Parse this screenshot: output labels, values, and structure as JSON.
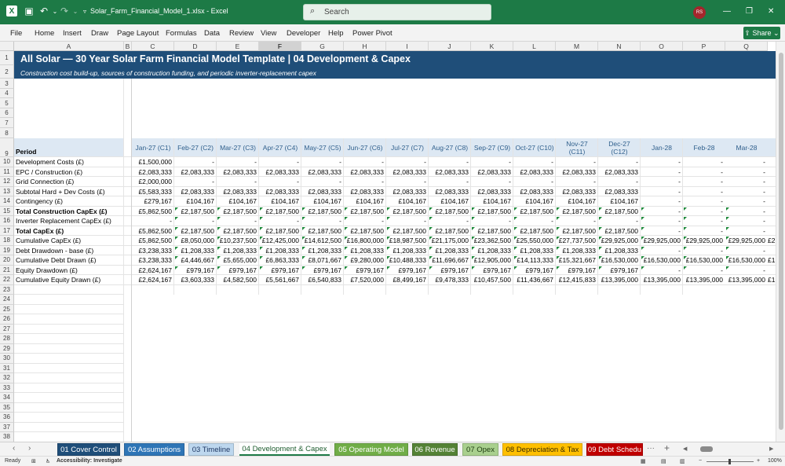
{
  "window": {
    "filename": "Solar_Farm_Financial_Model_1.xlsx",
    "app": "Excel",
    "title_sep": " - ",
    "search_placeholder": "Search",
    "user_initials": "RS"
  },
  "menu": [
    "File",
    "Home",
    "Insert",
    "Draw",
    "Page Layout",
    "Formulas",
    "Data",
    "Review",
    "View",
    "Developer",
    "Help",
    "Power Pivot"
  ],
  "share_label": "Share",
  "columns": [
    "A",
    "B",
    "C",
    "D",
    "E",
    "F",
    "G",
    "H",
    "I",
    "J",
    "K",
    "L",
    "M",
    "N",
    "O",
    "P",
    "Q"
  ],
  "selected_column": "F",
  "banner": {
    "title": "All Solar  —  30 Year Solar Farm Financial Model Template | 04 Development & Capex",
    "subtitle": "Construction cost build-up, sources of construction funding, and periodic inverter-replacement capex"
  },
  "period_label": "Period",
  "periods": [
    "Jan-27 (C1)",
    "Feb-27 (C2)",
    "Mar-27 (C3)",
    "Apr-27 (C4)",
    "May-27 (C5)",
    "Jun-27 (C6)",
    "Jul-27 (C7)",
    "Aug-27 (C8)",
    "Sep-27 (C9)",
    "Oct-27 (C10)",
    "Nov-27\n(C11)",
    "Dec-27\n(C12)",
    "Jan-28",
    "Feb-28",
    "Mar-28"
  ],
  "rows": [
    {
      "n": 10,
      "label": "Development Costs (£)",
      "bold": false,
      "values": [
        "£1,500,000",
        "-",
        "-",
        "-",
        "-",
        "-",
        "-",
        "-",
        "-",
        "-",
        "-",
        "-",
        "-",
        "-",
        "-"
      ]
    },
    {
      "n": 11,
      "label": "EPC / Construction (£)",
      "bold": false,
      "values": [
        "£2,083,333",
        "£2,083,333",
        "£2,083,333",
        "£2,083,333",
        "£2,083,333",
        "£2,083,333",
        "£2,083,333",
        "£2,083,333",
        "£2,083,333",
        "£2,083,333",
        "£2,083,333",
        "£2,083,333",
        "-",
        "-",
        "-"
      ]
    },
    {
      "n": 12,
      "label": "Grid Connection (£)",
      "bold": false,
      "values": [
        "£2,000,000",
        "-",
        "-",
        "-",
        "-",
        "-",
        "-",
        "-",
        "-",
        "-",
        "-",
        "-",
        "-",
        "-",
        "-"
      ]
    },
    {
      "n": 13,
      "label": "Subtotal Hard + Dev Costs (£)",
      "bold": false,
      "values": [
        "£5,583,333",
        "£2,083,333",
        "£2,083,333",
        "£2,083,333",
        "£2,083,333",
        "£2,083,333",
        "£2,083,333",
        "£2,083,333",
        "£2,083,333",
        "£2,083,333",
        "£2,083,333",
        "£2,083,333",
        "-",
        "-",
        "-"
      ]
    },
    {
      "n": 14,
      "label": "Contingency (£)",
      "bold": false,
      "values": [
        "£279,167",
        "£104,167",
        "£104,167",
        "£104,167",
        "£104,167",
        "£104,167",
        "£104,167",
        "£104,167",
        "£104,167",
        "£104,167",
        "£104,167",
        "£104,167",
        "-",
        "-",
        "-"
      ]
    },
    {
      "n": 15,
      "label": "Total Construction CapEx (£)",
      "bold": true,
      "values": [
        "£5,862,500",
        "£2,187,500",
        "£2,187,500",
        "£2,187,500",
        "£2,187,500",
        "£2,187,500",
        "£2,187,500",
        "£2,187,500",
        "£2,187,500",
        "£2,187,500",
        "£2,187,500",
        "£2,187,500",
        "-",
        "-",
        "-"
      ]
    },
    {
      "n": 16,
      "label": "Inverter Replacement CapEx (£)",
      "bold": false,
      "values": [
        "-",
        "-",
        "-",
        "-",
        "-",
        "-",
        "-",
        "-",
        "-",
        "-",
        "-",
        "-",
        "-",
        "-",
        "-"
      ]
    },
    {
      "n": 17,
      "label": "Total CapEx (£)",
      "bold": true,
      "values": [
        "£5,862,500",
        "£2,187,500",
        "£2,187,500",
        "£2,187,500",
        "£2,187,500",
        "£2,187,500",
        "£2,187,500",
        "£2,187,500",
        "£2,187,500",
        "£2,187,500",
        "£2,187,500",
        "£2,187,500",
        "-",
        "-",
        "-"
      ]
    },
    {
      "n": 18,
      "label": "Cumulative CapEx (£)",
      "bold": false,
      "values": [
        "£5,862,500",
        "£8,050,000",
        "£10,237,500",
        "£12,425,000",
        "£14,612,500",
        "£16,800,000",
        "£18,987,500",
        "£21,175,000",
        "£23,362,500",
        "£25,550,000",
        "£27,737,500",
        "£29,925,000",
        "£29,925,000",
        "£29,925,000",
        "£29,925,000"
      ]
    },
    {
      "n": 19,
      "label": "Debt Drawdown - base (£)",
      "bold": false,
      "values": [
        "£3,238,333",
        "£1,208,333",
        "£1,208,333",
        "£1,208,333",
        "£1,208,333",
        "£1,208,333",
        "£1,208,333",
        "£1,208,333",
        "£1,208,333",
        "£1,208,333",
        "£1,208,333",
        "£1,208,333",
        "-",
        "-",
        "-"
      ]
    },
    {
      "n": 20,
      "label": "Cumulative Debt Drawn (£)",
      "bold": false,
      "values": [
        "£3,238,333",
        "£4,446,667",
        "£5,655,000",
        "£6,863,333",
        "£8,071,667",
        "£9,280,000",
        "£10,488,333",
        "£11,696,667",
        "£12,905,000",
        "£14,113,333",
        "£15,321,667",
        "£16,530,000",
        "£16,530,000",
        "£16,530,000",
        "£16,530,000"
      ]
    },
    {
      "n": 21,
      "label": "Equity Drawdown (£)",
      "bold": false,
      "values": [
        "£2,624,167",
        "£979,167",
        "£979,167",
        "£979,167",
        "£979,167",
        "£979,167",
        "£979,167",
        "£979,167",
        "£979,167",
        "£979,167",
        "£979,167",
        "£979,167",
        "-",
        "-",
        "-"
      ]
    },
    {
      "n": 22,
      "label": "Cumulative Equity Drawn (£)",
      "bold": false,
      "values": [
        "£2,624,167",
        "£3,603,333",
        "£4,582,500",
        "£5,561,667",
        "£6,540,833",
        "£7,520,000",
        "£8,499,167",
        "£9,478,333",
        "£10,457,500",
        "£11,436,667",
        "£12,415,833",
        "£13,395,000",
        "£13,395,000",
        "£13,395,000",
        "£13,395,000"
      ]
    }
  ],
  "overflow_text": {
    "18": "£2",
    "20": "£1",
    "22": "£1"
  },
  "tabs": [
    {
      "label": "01 Cover Control",
      "bg": "#1f4e79",
      "fg": "#ffffff",
      "active": false
    },
    {
      "label": "02 Assumptions",
      "bg": "#2e75b6",
      "fg": "#ffffff",
      "active": false
    },
    {
      "label": "03 Timeline",
      "bg": "#bdd7ee",
      "fg": "#1f3864",
      "active": false
    },
    {
      "label": "04 Development & Capex",
      "bg": "#ffffff",
      "fg": "#1d5c2e",
      "active": true
    },
    {
      "label": "05 Operating Model",
      "bg": "#70ad47",
      "fg": "#ffffff",
      "active": false
    },
    {
      "label": "06 Revenue",
      "bg": "#548235",
      "fg": "#ffffff",
      "active": false
    },
    {
      "label": "07 Opex",
      "bg": "#a9d08e",
      "fg": "#1e3d10",
      "active": false
    },
    {
      "label": "08 Depreciation & Tax",
      "bg": "#ffc000",
      "fg": "#3a2a00",
      "active": false
    },
    {
      "label": "09 Debt Schedu",
      "bg": "#c00000",
      "fg": "#ffffff",
      "active": false
    }
  ],
  "tab_more": "···",
  "tab_add": "+",
  "status": {
    "ready": "Ready",
    "accessibility": "Accessibility: Investigate",
    "zoom": "100%"
  }
}
